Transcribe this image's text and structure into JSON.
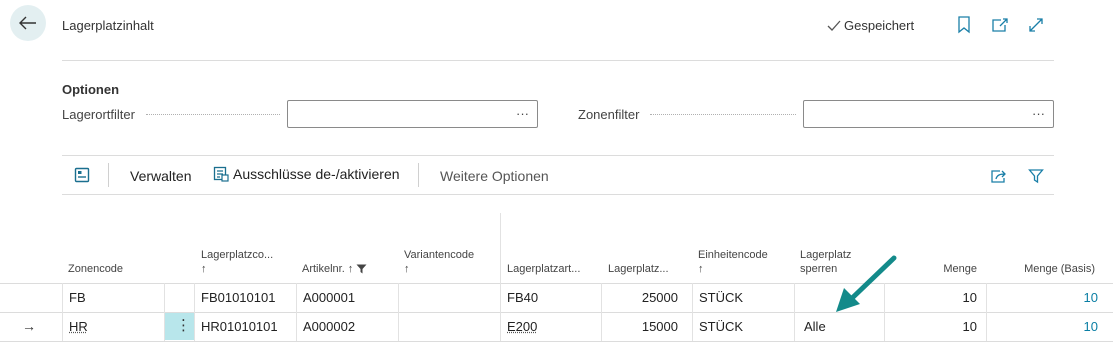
{
  "header": {
    "title": "Lagerplatzinhalt",
    "saved_label": "Gespeichert"
  },
  "options": {
    "title": "Optionen",
    "location_filter_label": "Lagerortfilter",
    "location_filter_value": "",
    "zone_filter_label": "Zonenfilter",
    "zone_filter_value": "",
    "ellipsis": "···"
  },
  "actions": {
    "manage_label": "Verwalten",
    "toggle_exclusions_label": "Ausschlüsse de-/aktivieren",
    "more_options_label": "Weitere Optionen"
  },
  "table": {
    "columns": {
      "zone_code": "Zonencode",
      "bin_code": "Lagerplatzco...",
      "bin_code_sort": "↑",
      "item_no": "Artikelnr.",
      "item_no_sort": "↑",
      "variant_code": "Variantencode",
      "variant_code_sort": "↑",
      "bin_type": "Lagerplatzart...",
      "bin_ranking": "Lagerplatz...",
      "unit_code": "Einheitencode",
      "unit_code_sort": "↑",
      "block_line1": "Lagerplatz",
      "block_line2": "sperren",
      "quantity": "Menge",
      "quantity_base": "Menge (Basis)"
    },
    "rows": [
      {
        "zone_code": "FB",
        "bin_code": "FB01010101",
        "item_no": "A000001",
        "variant_code": "",
        "bin_type": "FB40",
        "bin_ranking": "25000",
        "unit_code": "STÜCK",
        "block": "",
        "quantity": "10",
        "quantity_base": "10"
      },
      {
        "zone_code": "HR",
        "bin_code": "HR01010101",
        "item_no": "A000002",
        "variant_code": "",
        "bin_type": "E200",
        "bin_ranking": "15000",
        "unit_code": "STÜCK",
        "block": "Alle",
        "quantity": "10",
        "quantity_base": "10",
        "row_marker": "→",
        "row_menu": "⋮"
      }
    ]
  },
  "colors": {
    "accent": "#0a7ea4",
    "selection": "#b8e6eb",
    "annotation_arrow": "#138a8a"
  }
}
